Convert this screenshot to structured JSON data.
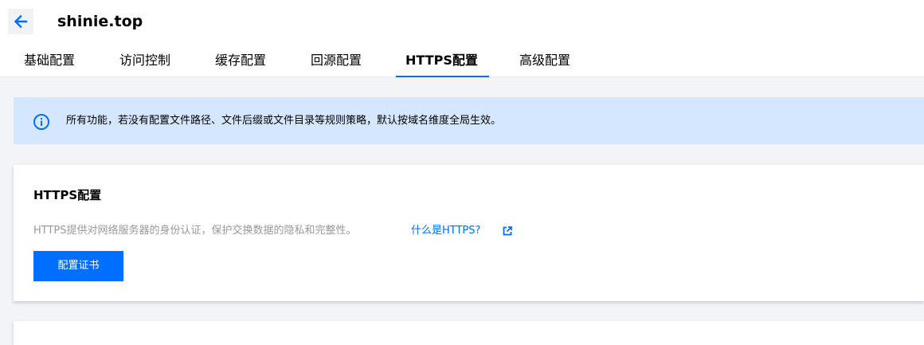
{
  "header": {
    "back_icon": "arrow-left-icon",
    "title": "shinie.top"
  },
  "tabs": [
    {
      "label": "基础配置",
      "active": false
    },
    {
      "label": "访问控制",
      "active": false
    },
    {
      "label": "缓存配置",
      "active": false
    },
    {
      "label": "回源配置",
      "active": false
    },
    {
      "label": "HTTPS配置",
      "active": true
    },
    {
      "label": "高级配置",
      "active": false
    }
  ],
  "notice": {
    "icon": "info-icon",
    "text": "所有功能，若没有配置文件路径、文件后缀或文件目录等规则策略，默认按域名维度全局生效。"
  },
  "https_card": {
    "title": "HTTPS配置",
    "description": "HTTPS提供对网络服务器的身份认证，保护交换数据的隐私和完整性。",
    "link_label": "什么是HTTPS?",
    "link_icon": "external-link-icon",
    "button_label": "配置证书"
  },
  "colors": {
    "accent": "#006eff",
    "notice_bg": "#d5e7ff",
    "page_bg": "#f2f4f7",
    "muted_text": "#999999"
  }
}
